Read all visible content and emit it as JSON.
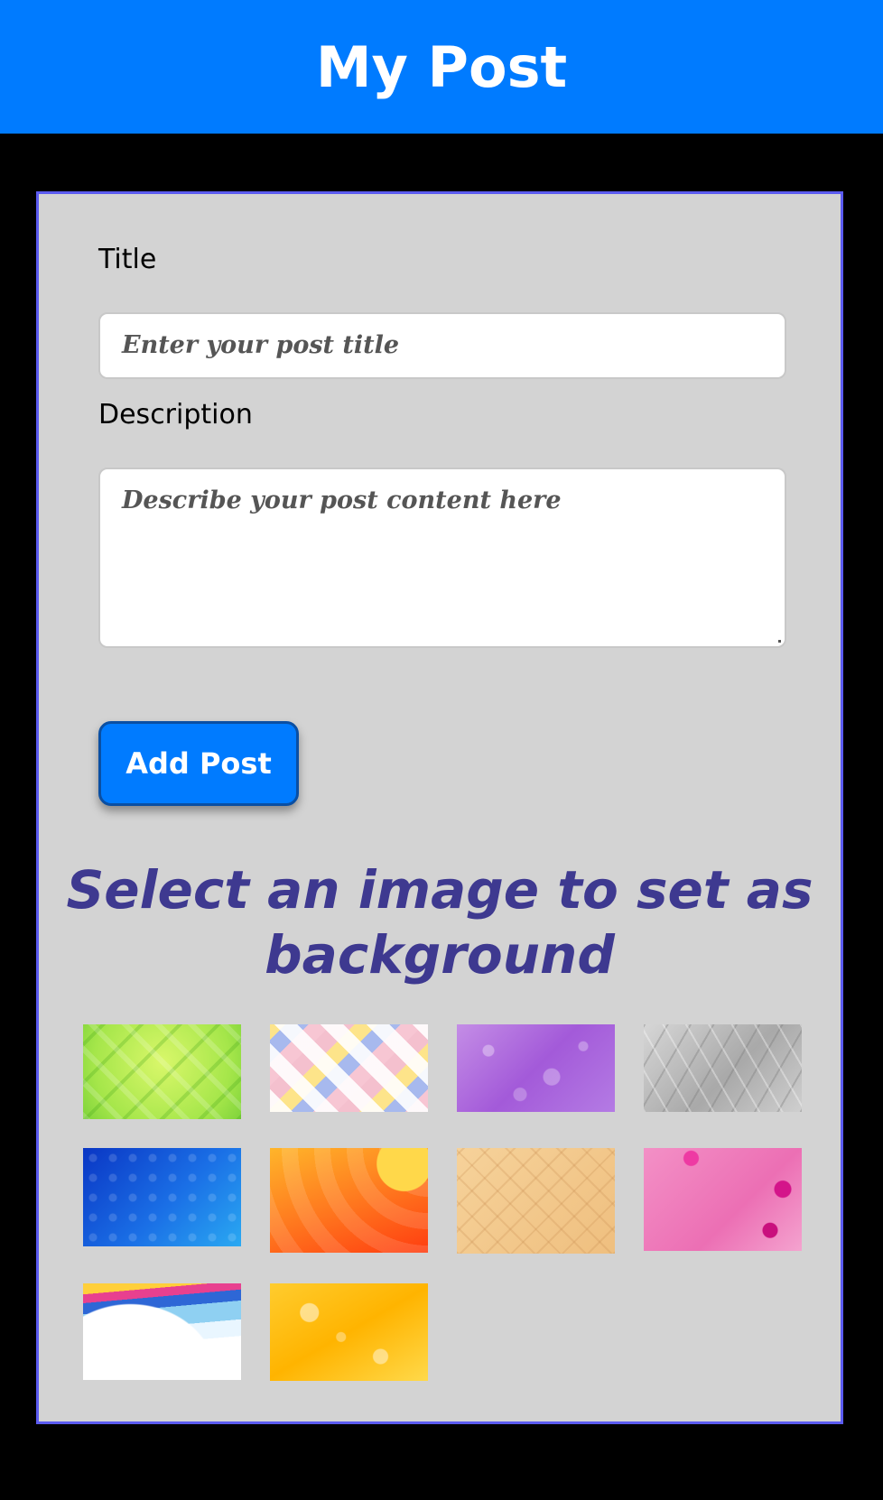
{
  "header": {
    "title": "My Post"
  },
  "form": {
    "title_label": "Title",
    "title_placeholder": "Enter your post title",
    "description_label": "Description",
    "description_placeholder": "Describe your post content here",
    "add_button_label": "Add Post"
  },
  "gallery": {
    "heading": "Select an image to set as background",
    "images": [
      {
        "name": "green-geometric-background"
      },
      {
        "name": "pastel-plaid-background"
      },
      {
        "name": "purple-bokeh-background"
      },
      {
        "name": "gray-triangles-background"
      },
      {
        "name": "blue-damask-background"
      },
      {
        "name": "orange-abstract-background"
      },
      {
        "name": "beige-pattern-background"
      },
      {
        "name": "pink-hexagon-background"
      },
      {
        "name": "rainbow-wave-background"
      },
      {
        "name": "yellow-bubbles-background"
      }
    ]
  },
  "colors": {
    "header_bg": "#007bff",
    "page_bg": "#000000",
    "card_bg": "#d3d3d3",
    "card_border": "#5b5bf0",
    "heading_color": "#3e3990"
  }
}
